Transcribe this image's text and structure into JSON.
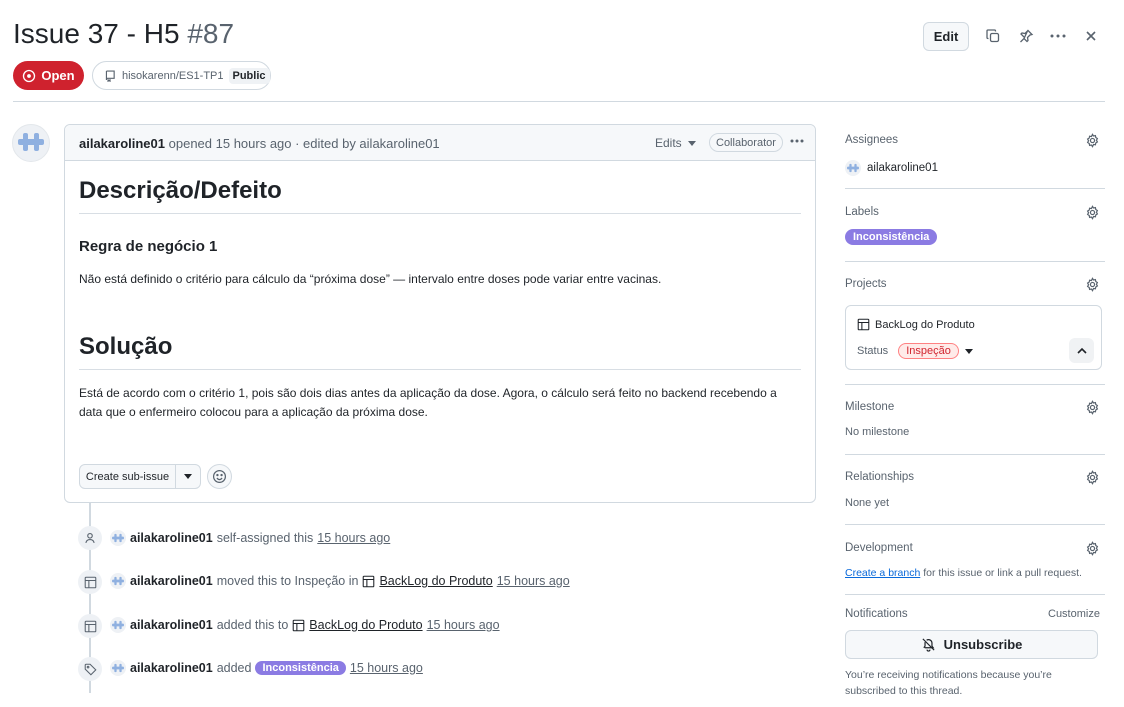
{
  "issue": {
    "title": "Issue 37 - H5",
    "number": "#87",
    "state": "Open",
    "repo": "hisokarenn/ES1-TP1",
    "visibility": "Public"
  },
  "header": {
    "edit_label": "Edit",
    "icons": [
      "copy-icon",
      "pin-icon",
      "kebab-icon",
      "close-icon"
    ]
  },
  "comment": {
    "author": "ailakaroline01",
    "meta": "opened 15 hours ago · edited by ailakaroline01",
    "edits_label": "Edits",
    "role": "Collaborator",
    "heading1": "Descrição/Defeito",
    "heading2": "Regra de negócio 1",
    "paragraph1": "Não está definido o critério para cálculo da “próxima dose” — intervalo entre doses pode variar entre vacinas.",
    "heading3": "Solução",
    "paragraph2": "Está de acordo com o critério 1, pois são dois dias antes da aplicação da dose. Agora, o cálculo será feito no backend recebendo a data que o enfermeiro colocou para a aplicação da próxima dose.",
    "create_subissue_label": "Create sub-issue"
  },
  "timeline": [
    {
      "actor": "ailakaroline01",
      "text": "self-assigned this",
      "time": "15 hours ago"
    },
    {
      "actor": "ailakaroline01",
      "text": "moved this to Inspeção in",
      "link": "BackLog do Produto",
      "time": "15 hours ago"
    },
    {
      "actor": "ailakaroline01",
      "text": "added this to",
      "link": "BackLog do Produto",
      "time": "15 hours ago"
    },
    {
      "actor": "ailakaroline01",
      "text": "added",
      "label": "Inconsistência",
      "time": "15 hours ago"
    }
  ],
  "sidebar": {
    "assignees_title": "Assignees",
    "assignee": "ailakaroline01",
    "labels_title": "Labels",
    "label": "Inconsistência",
    "projects_title": "Projects",
    "project_name": "BackLog do Produto",
    "status_label": "Status",
    "status_value": "Inspeção",
    "milestone_title": "Milestone",
    "milestone_value": "No milestone",
    "relationships_title": "Relationships",
    "relationships_value": "None yet",
    "development_title": "Development",
    "development_link": "Create a branch",
    "development_text": "for this issue or link a pull request.",
    "notifications_title": "Notifications",
    "customize_label": "Customize",
    "unsubscribe_label": "Unsubscribe",
    "notifications_text": "You’re receiving notifications because you’re subscribed to this thread."
  },
  "colors": {
    "open_red": "#cf222e",
    "label_purple": "#8b7be3",
    "link_blue": "#0969da",
    "status_red": "#d1242f"
  }
}
